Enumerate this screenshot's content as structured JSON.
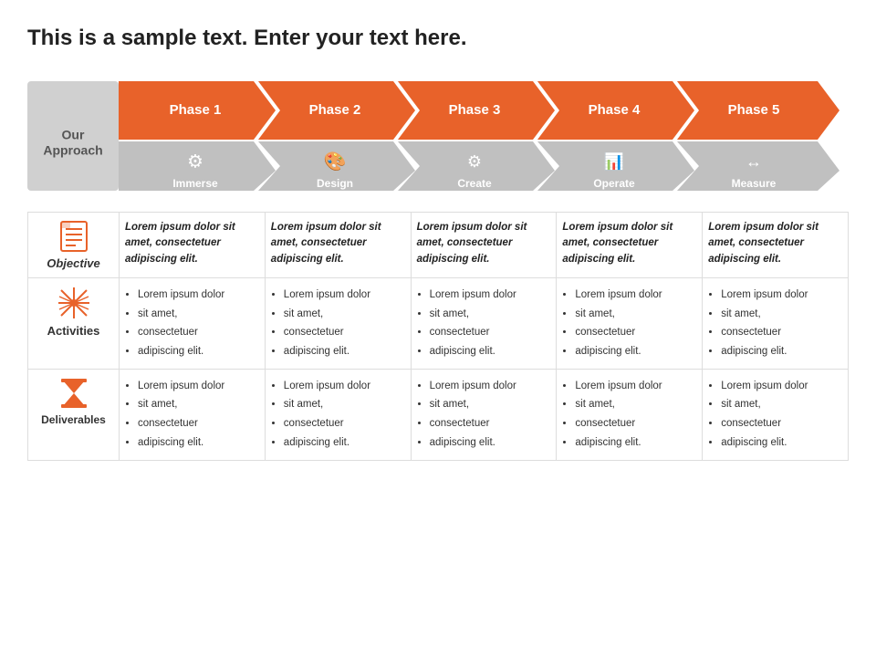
{
  "title": "This is a sample text. Enter your text here.",
  "approach": {
    "label": "Our\nApproach"
  },
  "phases": [
    {
      "id": 1,
      "label": "Phase 1",
      "sublabel": "Immerse",
      "icon": "⚙",
      "icon_unicode": "&#x2699;"
    },
    {
      "id": 2,
      "label": "Phase 2",
      "sublabel": "Design",
      "icon": "🎨",
      "icon_unicode": "&#x1F3A8;"
    },
    {
      "id": 3,
      "label": "Phase 3",
      "sublabel": "Create",
      "icon": "⚙",
      "icon_unicode": "&#x2699;"
    },
    {
      "id": 4,
      "label": "Phase 4",
      "sublabel": "Operate",
      "icon": "📊",
      "icon_unicode": "&#x1F4CA;"
    },
    {
      "id": 5,
      "label": "Phase 5",
      "sublabel": "Measure",
      "icon": "↔",
      "icon_unicode": "&#x2194;"
    }
  ],
  "rows": [
    {
      "id": "objective",
      "label": "Objective",
      "icon": "📋",
      "cells": [
        "Lorem ipsum dolor sit amet, consectetuer adipiscing elit.",
        "Lorem ipsum dolor sit amet, consectetuer adipiscing elit.",
        "Lorem ipsum dolor sit amet, consectetuer adipiscing elit.",
        "Lorem ipsum dolor sit amet, consectetuer adipiscing elit.",
        "Lorem ipsum dolor sit amet, consectetuer adipiscing elit."
      ]
    },
    {
      "id": "activities",
      "label": "Activities",
      "icon": "✦",
      "cells": [
        [
          "Lorem ipsum dolor",
          "sit amet,",
          "consectetuer",
          "adipiscing elit."
        ],
        [
          "Lorem ipsum dolor",
          "sit amet,",
          "consectetuer",
          "adipiscing elit."
        ],
        [
          "Lorem ipsum dolor",
          "sit amet,",
          "consectetuer",
          "adipiscing elit."
        ],
        [
          "Lorem ipsum dolor",
          "sit amet,",
          "consectetuer",
          "adipiscing elit."
        ],
        [
          "Lorem ipsum dolor",
          "sit amet,",
          "consectetuer",
          "adipiscing elit."
        ]
      ]
    },
    {
      "id": "deliverables",
      "label": "Deliverables",
      "icon": "⏳",
      "cells": [
        [
          "Lorem ipsum dolor",
          "sit amet,",
          "consectetuer",
          "adipiscing elit."
        ],
        [
          "Lorem ipsum dolor",
          "sit amet,",
          "consectetuer",
          "adipiscing elit."
        ],
        [
          "Lorem ipsum dolor",
          "sit amet,",
          "consectetuer",
          "adipiscing elit."
        ],
        [
          "Lorem ipsum dolor",
          "sit amet,",
          "consectetuer",
          "adipiscing elit."
        ],
        [
          "Lorem ipsum dolor",
          "sit amet,",
          "consectetuer",
          "adipiscing elit."
        ]
      ]
    }
  ],
  "colors": {
    "orange": "#e8622a",
    "gray": "#b0b0b0",
    "white": "#ffffff"
  }
}
